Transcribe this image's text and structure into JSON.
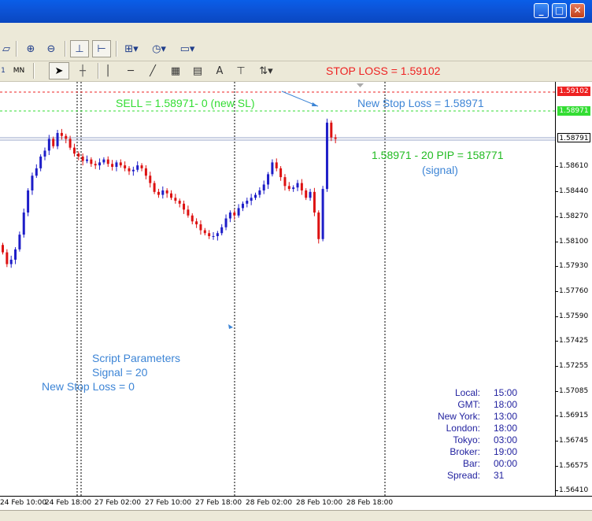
{
  "window": {
    "controls": [
      "_",
      "□",
      "✕"
    ],
    "mdi_controls": [
      "_",
      "▫",
      "✕"
    ]
  },
  "toolbar2": {
    "tf_mn": "MN",
    "tf_1": "1"
  },
  "chart": {
    "stop_loss_label": "STOP LOSS = 1.59102",
    "sell_label": "SELL = 1.58971- 0 (new SL)",
    "new_sl_label": "New Stop Loss = 1.58971",
    "signal_line1": "1.58971 - 20 PIP = 158771",
    "signal_line2": "(signal)",
    "script_title": "Script   Parameters",
    "script_signal": "Signal = 20",
    "script_new_sl": "New Stop Loss = 0"
  },
  "price_axis": {
    "labels": [
      "1.59102",
      "1.58971",
      "1.58791",
      "1.58610",
      "1.58440",
      "1.58270",
      "1.58100",
      "1.57930",
      "1.57760",
      "1.57590",
      "1.57425",
      "1.57255",
      "1.57085",
      "1.56915",
      "1.56745",
      "1.56575",
      "1.56410"
    ],
    "label_min": 1.5641,
    "label_max": 1.5861,
    "stop_loss_price": 1.59102,
    "sell_price": 1.58971,
    "bid_price": 1.58791
  },
  "time_axis": {
    "labels": [
      "24 Feb 10:00",
      "24 Feb 18:00",
      "27 Feb 02:00",
      "27 Feb 10:00",
      "27 Feb 18:00",
      "28 Feb 02:00",
      "28 Feb 10:00",
      "28 Feb 18:00"
    ]
  },
  "clock": [
    {
      "key": "Local:",
      "value": "15:00"
    },
    {
      "key": "GMT:",
      "value": "18:00"
    },
    {
      "key": "New York:",
      "value": "13:00"
    },
    {
      "key": "London:",
      "value": "18:00"
    },
    {
      "key": "Tokyo:",
      "value": "03:00"
    },
    {
      "key": "Broker:",
      "value": "19:00"
    },
    {
      "key": "Bar:",
      "value": "00:00"
    },
    {
      "key": "Spread:",
      "value": "31"
    }
  ],
  "colors": {
    "stop_loss": "#ee2222",
    "sell": "#33dd33",
    "info_blue": "#3d85d6",
    "bull": "#1d1dc8",
    "bear": "#dd1111",
    "clock": "#2323a0",
    "signal_green": "#22bb22"
  },
  "chart_data": {
    "type": "candlestick",
    "x": [
      "24 Feb 10:00",
      "24 Feb 18:00",
      "27 Feb 02:00",
      "27 Feb 10:00",
      "27 Feb 18:00",
      "28 Feb 02:00",
      "28 Feb 10:00",
      "28 Feb 18:00"
    ],
    "close": [
      1.5802,
      1.5878,
      1.5858,
      1.584,
      1.5815,
      1.5842,
      1.585,
      1.5883
    ],
    "ylim": [
      1.5641,
      1.5925
    ],
    "levels": [
      1.59102,
      1.58971,
      1.58791
    ]
  }
}
